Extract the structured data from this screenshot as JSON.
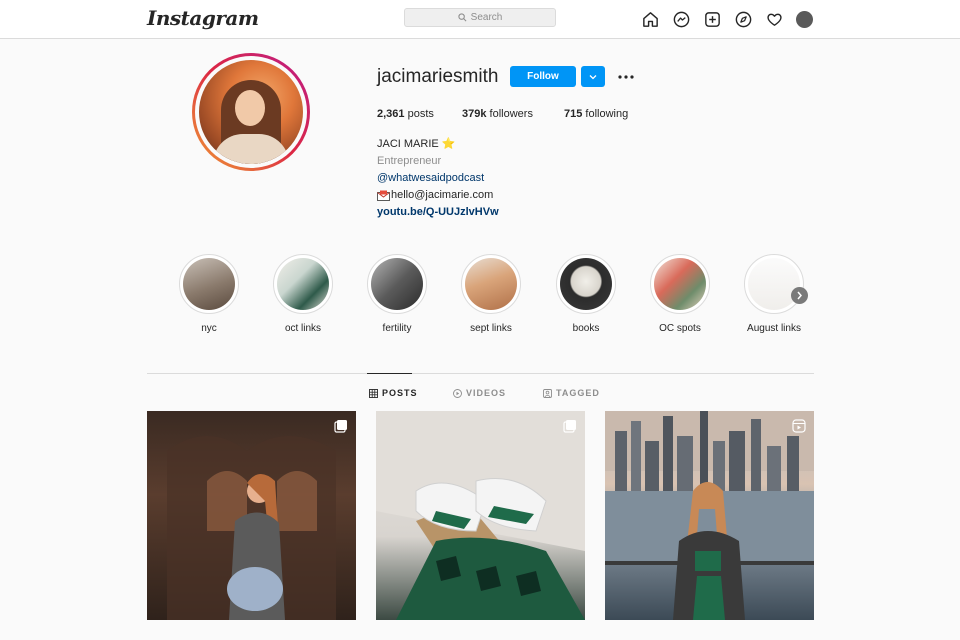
{
  "nav": {
    "logo": "Instagram",
    "search_placeholder": "Search",
    "icons": [
      "home-icon",
      "messenger-icon",
      "new-post-icon",
      "explore-icon",
      "activity-heart-icon",
      "profile-avatar"
    ]
  },
  "profile": {
    "username": "jacimariesmith",
    "follow_label": "Follow",
    "stats": {
      "posts_count": "2,361",
      "posts_label": "posts",
      "followers_count": "379k",
      "followers_label": "followers",
      "following_count": "715",
      "following_label": "following"
    },
    "bio": {
      "name": "JACI MARIE ⭐",
      "category": "Entrepreneur",
      "mention": "@whatwesaidpodcast",
      "email": "hello@jacimarie.com",
      "url": "youtu.be/Q-UUJzlvHVw"
    }
  },
  "highlights": [
    {
      "label": "nyc"
    },
    {
      "label": "oct links"
    },
    {
      "label": "fertility"
    },
    {
      "label": "sept links"
    },
    {
      "label": "books"
    },
    {
      "label": "OC spots"
    },
    {
      "label": "August links"
    }
  ],
  "tabs": [
    {
      "label": "POSTS",
      "active": true
    },
    {
      "label": "VIDEOS",
      "active": false
    },
    {
      "label": "TAGGED",
      "active": false
    }
  ],
  "colors": {
    "accent": "#0095f6",
    "link": "#00376b",
    "muted": "#8e8e8e"
  }
}
